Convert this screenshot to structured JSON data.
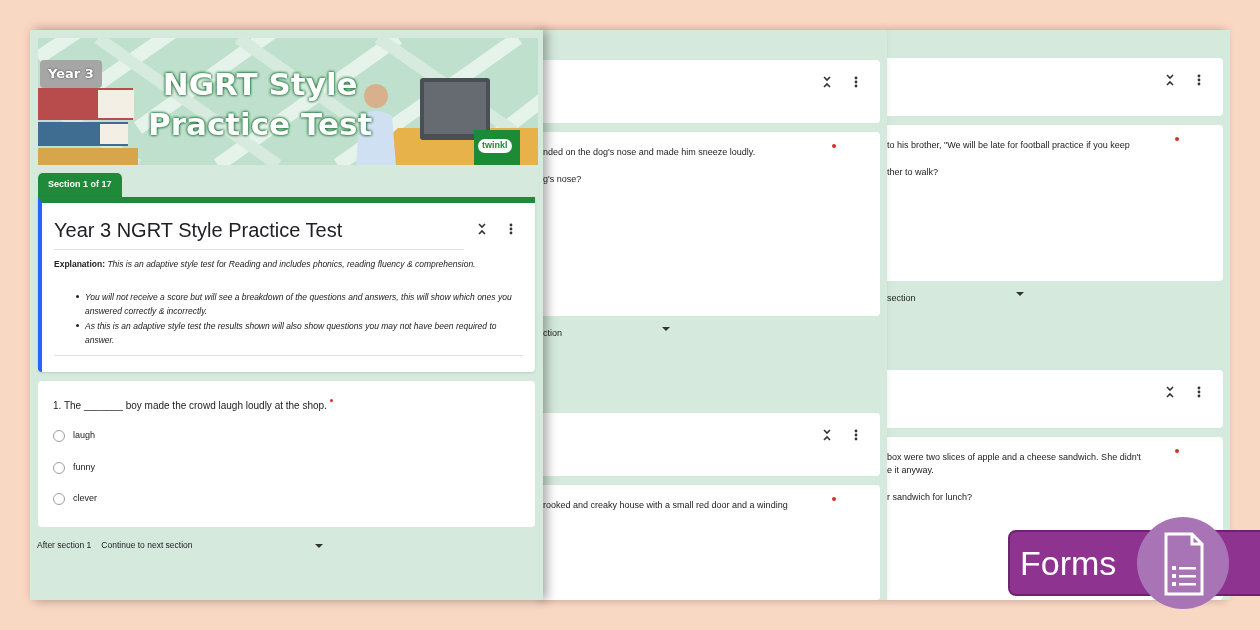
{
  "banner": {
    "badge": "Year 3",
    "title_lines": [
      "NGRT Style",
      "Practice Test"
    ],
    "logo": "twinkl"
  },
  "section_tab": "Section 1 of 17",
  "header_card": {
    "title": "Year 3 NGRT Style Practice Test",
    "description": "**Explanation:** *This is an adaptive style test for Reading and includes phonics, reading fluency & comprehension.*",
    "bullets": [
      "You will not receive a score but will see a breakdown of the questions and answers, this will show which ones you answered correctly & incorrectly.",
      "As this is an adaptive style test the results shown will also show questions you may not have been required to answer."
    ]
  },
  "question": {
    "text": "1. The _______ boy made the crowd laugh loudly at the shop.",
    "required": true,
    "options": [
      {
        "label": "laugh",
        "selected": false
      },
      {
        "label": "funny",
        "selected": false
      },
      {
        "label": "clever",
        "selected": false
      }
    ]
  },
  "after_section": {
    "label": "After section 1",
    "value": "Continue to next section"
  },
  "background_panels": [
    {
      "items": [
        {
          "kind": "header"
        },
        {
          "kind": "question",
          "required": true,
          "paragraphs": [
            [
              "nded on the dog's nose and made him sneeze loudly."
            ],
            [
              "g's nose?"
            ]
          ]
        },
        {
          "kind": "footer",
          "text": "ction"
        },
        {
          "kind": "header"
        },
        {
          "kind": "question",
          "required": true,
          "paragraphs": [
            [
              "rooked and creaky house with a small red door and a winding"
            ]
          ]
        }
      ]
    },
    {
      "items": [
        {
          "kind": "header"
        },
        {
          "kind": "question",
          "required": true,
          "paragraphs": [
            [
              "to his brother, \"We will be late for football practice if you keep"
            ],
            [
              "ther to walk?"
            ]
          ]
        },
        {
          "kind": "footer",
          "text": "section"
        },
        {
          "kind": "header"
        },
        {
          "kind": "question",
          "required": true,
          "paragraphs": [
            [
              "box were two slices of apple and a cheese sandwich. She didn't",
              "e it anyway."
            ],
            [
              "r sandwich for lunch?"
            ]
          ]
        }
      ]
    }
  ],
  "badge": {
    "label": "Forms"
  }
}
